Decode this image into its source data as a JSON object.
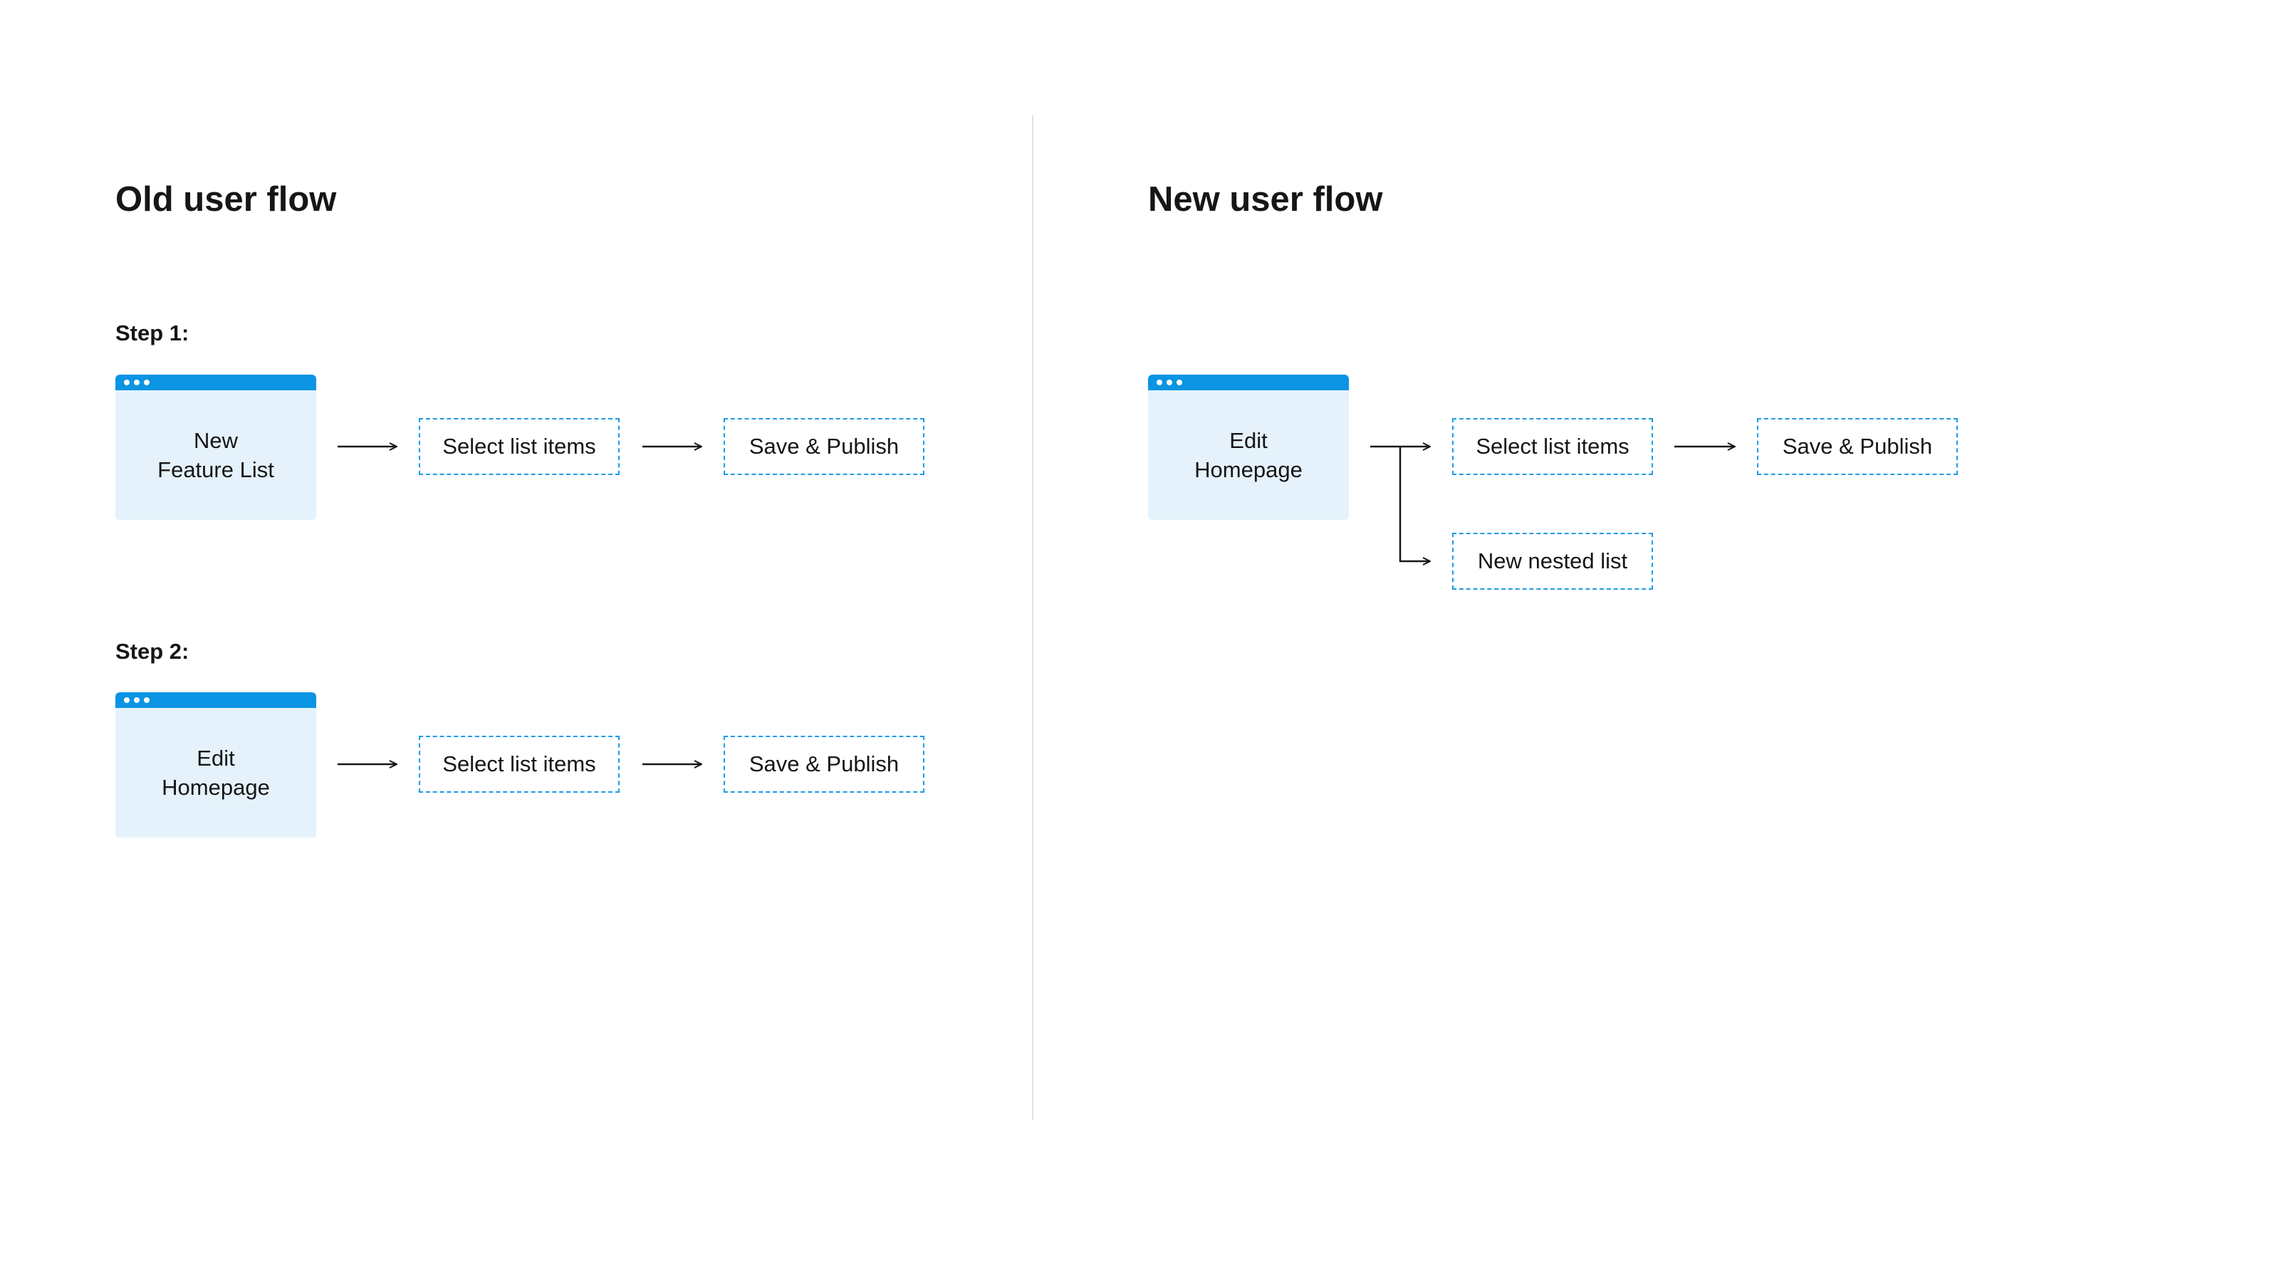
{
  "old_flow": {
    "title": "Old user flow",
    "steps": [
      {
        "label": "Step 1:",
        "card": {
          "line1": "New",
          "line2": "Feature List"
        },
        "boxes": [
          "Select list items",
          "Save & Publish"
        ]
      },
      {
        "label": "Step 2:",
        "card": {
          "line1": "Edit",
          "line2": "Homepage"
        },
        "boxes": [
          "Select list items",
          "Save & Publish"
        ]
      }
    ]
  },
  "new_flow": {
    "title": "New user flow",
    "card": {
      "line1": "Edit",
      "line2": "Homepage"
    },
    "boxes": [
      "Select list items",
      "Save & Publish"
    ],
    "branch_box": "New nested list"
  },
  "colors": {
    "accent": "#0b94e3",
    "card_fill": "#e5f2fb",
    "dashed_border": "#1f9be6",
    "divider": "#e0e0e0",
    "text": "#161616"
  }
}
